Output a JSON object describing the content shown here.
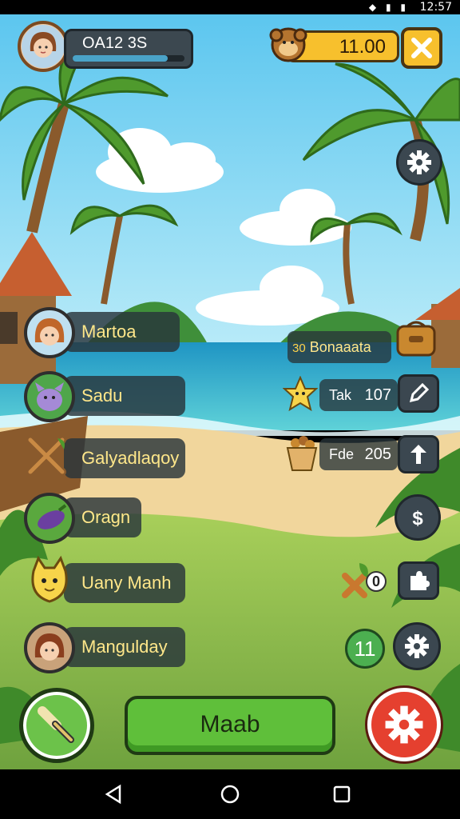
{
  "status_bar": {
    "time": "12:57"
  },
  "profile": {
    "name": "OA12 3S"
  },
  "currency": {
    "value": "11.00"
  },
  "players": [
    {
      "name": "Martoa"
    },
    {
      "name": "Sadu"
    },
    {
      "name": "Galyadlaqoy"
    },
    {
      "name": "Oragn"
    },
    {
      "name": "Uany Manh"
    },
    {
      "name": "Mangulday"
    }
  ],
  "bonus_row": {
    "prefix": "30",
    "label": "Bonaaata"
  },
  "resource_rows": [
    {
      "label": "Tak",
      "value": "107"
    },
    {
      "label": "Fde",
      "value": "205"
    }
  ],
  "item_count": "0",
  "level_badge": "11",
  "main_button": {
    "label": "Maab"
  },
  "colors": {
    "sky": "#7fd3f2",
    "sea": "#2fb0cf",
    "sand": "#f0d59a",
    "grass": "#8dbb4e",
    "accent_yellow": "#f7c02d",
    "button_green": "#5fbf3a",
    "button_red": "#e5402f"
  }
}
